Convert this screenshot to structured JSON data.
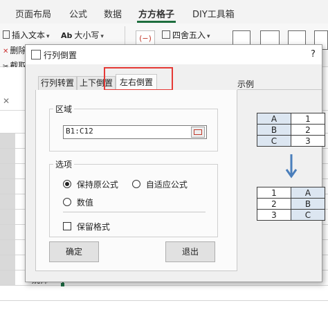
{
  "ribbon": {
    "tabs": [
      "页面布局",
      "公式",
      "数据",
      "方方格子",
      "DIY工具箱"
    ],
    "active_tab": "方方格子",
    "buttons": {
      "insert_text": "插入文本",
      "case": "大小写",
      "delete": "删除",
      "cut_fetch": "截取",
      "round": "四舍五入"
    }
  },
  "sheet": {
    "partial_cell_text": "姚师"
  },
  "dialog": {
    "title": "行列倒置",
    "help": "?",
    "tabs": [
      "行列转置",
      "上下倒置",
      "左右倒置"
    ],
    "active_tab": "左右倒置",
    "highlight_color": "#e53935",
    "region": {
      "label": "区域",
      "value": "B1:C12"
    },
    "options": {
      "label": "选项",
      "radio_keep_formula": "保持原公式",
      "radio_adaptive_formula": "自适应公式",
      "radio_values": "数值",
      "selected": "保持原公式",
      "keep_format_label": "保留格式",
      "keep_format_checked": false
    },
    "buttons": {
      "ok": "确定",
      "exit": "退出"
    },
    "example": {
      "label": "示例",
      "before": [
        [
          "A",
          "1"
        ],
        [
          "B",
          "2"
        ],
        [
          "C",
          "3"
        ]
      ],
      "after": [
        [
          "1",
          "A"
        ],
        [
          "2",
          "B"
        ],
        [
          "3",
          "C"
        ]
      ],
      "shaded_color": "#dce6f1",
      "arrow_color": "#4a7ebb"
    }
  }
}
